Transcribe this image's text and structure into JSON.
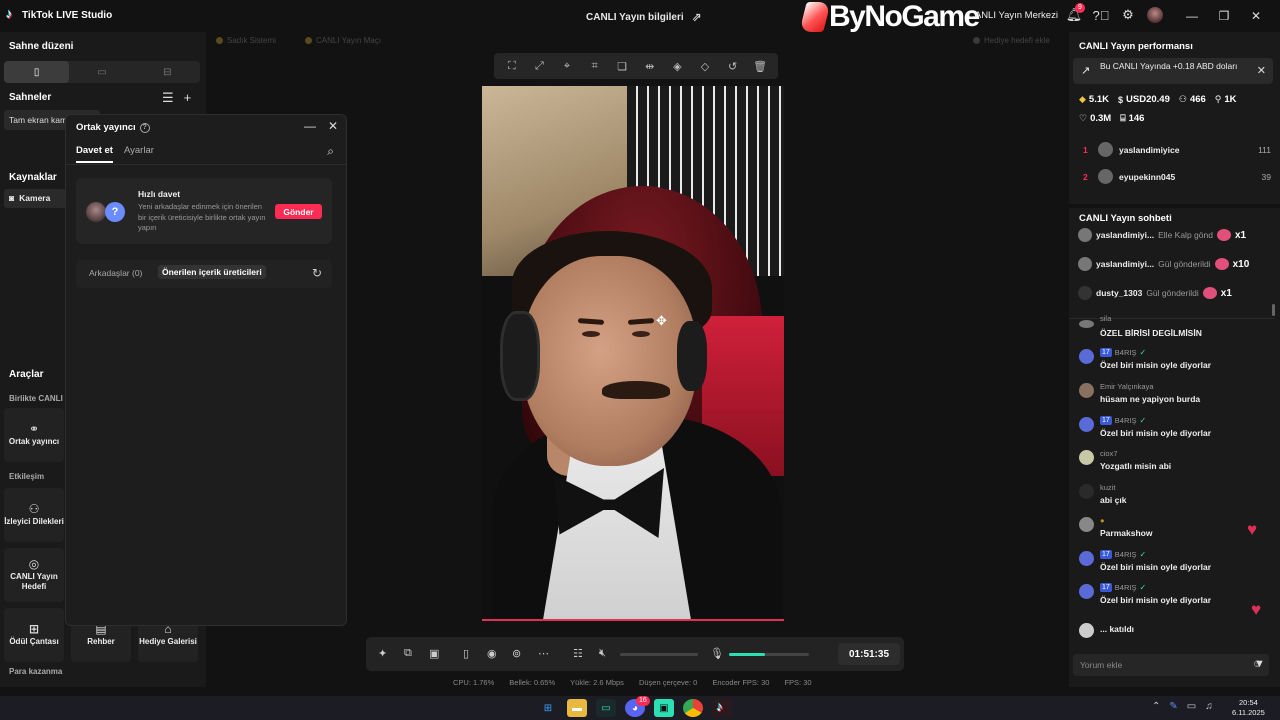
{
  "titlebar": {
    "app_name": "TikTok LIVE Studio",
    "center_title": "CANLI Yayın bilgileri",
    "watermark": "ByNoGame",
    "right_center": "CANLI Yayın Merkezi",
    "notification_count": "9"
  },
  "left_panel": {
    "scene_layout_title": "Sahne düzeni",
    "scenes_title": "Sahneler",
    "scene_item": "Tam ekran kamera",
    "sources_title": "Kaynaklar",
    "source_item": "Kamera",
    "tools_title": "Araçlar",
    "together_label": "Birlikte CANLI",
    "tool_cohost": "Ortak yayıncı",
    "interaction_label": "Etkileşim",
    "tool_viewer_requests": "İzleyici Dilekleri",
    "tool_live_goal": "CANLI Yayın Hedefi",
    "tool_reward_bag": "Ödül Çantası",
    "tool_guide": "Rehber",
    "tool_gift_gallery": "Hediye Galerisi",
    "earn_label": "Para kazanma"
  },
  "ghost_labels": {
    "left1": "Sadık Sistemi",
    "left2": "CANLI Yayın Maçı",
    "right1": "Hediye hedefi ekle"
  },
  "dialog": {
    "title": "Ortak yayıncı",
    "tab_invite": "Davet et",
    "tab_settings": "Ayarlar",
    "quick_invite_title": "Hızlı davet",
    "quick_invite_desc": "Yeni arkadaşlar edinmek için önerilen bir içerik üreticisiyle birlikte ortak yayın yapın",
    "send_button": "Gönder",
    "friends_tab": "Arkadaşlar (0)",
    "suggested_tab": "Önerilen içerik üreticileri"
  },
  "video_controls": {
    "timer": "01:51:35",
    "mic_level": 0.45,
    "speaker_level": 0.0
  },
  "stats": {
    "cpu": "CPU: 1.76%",
    "memory": "Bellek: 0.65%",
    "upload": "Yükle: 2.6 Mbps",
    "dropped": "Düşen çerçeve: 0",
    "encoder_fps": "Encoder FPS: 30",
    "fps": "FPS: 30"
  },
  "right_panel": {
    "performance_title": "CANLI Yayın performansı",
    "revenue_banner": "Bu CANLI Yayında +0.18 ABD doları",
    "metrics": [
      {
        "icon": "diamond-icon",
        "value": "5.1K"
      },
      {
        "icon": "dollar-icon",
        "value": "USD20.49"
      },
      {
        "icon": "viewers-icon",
        "value": "466"
      },
      {
        "icon": "followers-icon",
        "value": "1K"
      }
    ],
    "metrics2": [
      {
        "icon": "heart-icon",
        "value": "0.3M"
      },
      {
        "icon": "gift-icon",
        "value": "146"
      }
    ],
    "ranking": [
      {
        "rank": "1",
        "name": "yaslandimiyice",
        "value": "111"
      },
      {
        "rank": "2",
        "name": "eyupekinn045",
        "value": "39"
      }
    ],
    "chat_title": "CANLI Yayın sohbeti",
    "gifts": [
      {
        "name": "yaslandimiyi...",
        "action": "Elle Kalp gönd",
        "count": "x1"
      },
      {
        "name": "yaslandimiyi...",
        "action": "Gül gönderildi",
        "count": "x10"
      },
      {
        "name": "dusty_1303",
        "action": "Gül gönderildi",
        "count": "x1"
      }
    ],
    "chat": [
      {
        "user": "sila",
        "level": "",
        "text": "ÖZEL BİRİSİ DEGİLMİSİN"
      },
      {
        "user": "B4RIŞ",
        "level": "17",
        "text": "Özel biri misin oyle diyorlar"
      },
      {
        "user": "Emir Yalçınkaya",
        "level": "",
        "text": "hüsam ne yapiyon burda"
      },
      {
        "user": "B4RIŞ",
        "level": "17",
        "text": "Özel biri misin oyle diyorlar"
      },
      {
        "user": "ciox7",
        "level": "",
        "text": "Yozgatlı misin abi"
      },
      {
        "user": "kuzit",
        "level": "",
        "text": "abi çık"
      },
      {
        "user": "",
        "level": "",
        "text": "Parmakshow"
      },
      {
        "user": "B4RIŞ",
        "level": "17",
        "text": "Özel biri misin oyle diyorlar"
      },
      {
        "user": "B4RIŞ",
        "level": "17",
        "text": "Özel biri misin oyle diyorlar"
      }
    ],
    "joined_text": "... katıldı",
    "comment_placeholder": "Yorum ekle"
  },
  "taskbar": {
    "time": "20:54",
    "date": "6.11.2025",
    "discord_badge": "16"
  },
  "colors": {
    "accent": "#fe2c55",
    "teal": "#2de0b4",
    "panel": "#1a1a1a",
    "background": "#121212"
  }
}
